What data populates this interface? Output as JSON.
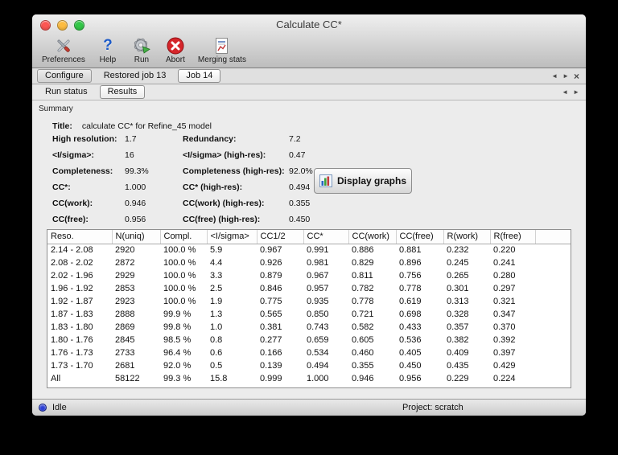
{
  "window": {
    "title": "Calculate CC*"
  },
  "toolbar": {
    "items": [
      {
        "id": "preferences",
        "label": "Preferences",
        "icon": "preferences-icon"
      },
      {
        "id": "help",
        "label": "Help",
        "icon": "help-icon"
      },
      {
        "id": "run",
        "label": "Run",
        "icon": "run-icon"
      },
      {
        "id": "abort",
        "label": "Abort",
        "icon": "abort-icon"
      },
      {
        "id": "merging-stats",
        "label": "Merging stats",
        "icon": "merging-stats-icon"
      }
    ]
  },
  "tabs": {
    "items": [
      {
        "label": "Configure",
        "active": false,
        "boxed": true
      },
      {
        "label": "Restored job 13",
        "active": false,
        "boxed": false
      },
      {
        "label": "Job 14",
        "active": true,
        "boxed": true
      }
    ]
  },
  "subtabs": {
    "items": [
      {
        "label": "Run status",
        "active": false,
        "boxed": false
      },
      {
        "label": "Results",
        "active": true,
        "boxed": true
      }
    ]
  },
  "tab_controls": {
    "scroll_left": "◄",
    "scroll_right": "►",
    "close": "×"
  },
  "summary": {
    "section_label": "Summary",
    "title_label": "Title:",
    "title_value": "calculate CC* for Refine_45 model",
    "rows": [
      {
        "label1": "High resolution:",
        "value1": "1.7",
        "label2": "Redundancy:",
        "value2": "7.2"
      },
      {
        "label1": "<I/sigma>:",
        "value1": "16",
        "label2": "<I/sigma> (high-res):",
        "value2": "0.47"
      },
      {
        "label1": "Completeness:",
        "value1": "99.3%",
        "label2": "Completeness (high-res):",
        "value2": "92.0%"
      },
      {
        "label1": "CC*:",
        "value1": "1.000",
        "label2": "CC* (high-res):",
        "value2": "0.494"
      },
      {
        "label1": "CC(work):",
        "value1": "0.946",
        "label2": "CC(work) (high-res):",
        "value2": "0.355"
      },
      {
        "label1": "CC(free):",
        "value1": "0.956",
        "label2": "CC(free) (high-res):",
        "value2": "0.450"
      }
    ],
    "display_graphs_label": "Display graphs"
  },
  "table": {
    "columns": [
      "Reso.",
      "N(uniq)",
      "Compl.",
      "<I/sigma>",
      "CC1/2",
      "CC*",
      "CC(work)",
      "CC(free)",
      "R(work)",
      "R(free)"
    ],
    "rows": [
      [
        "2.14 - 2.08",
        "2920",
        "100.0 %",
        "5.9",
        "0.967",
        "0.991",
        "0.886",
        "0.881",
        "0.232",
        "0.220"
      ],
      [
        "2.08 - 2.02",
        "2872",
        "100.0 %",
        "4.4",
        "0.926",
        "0.981",
        "0.829",
        "0.896",
        "0.245",
        "0.241"
      ],
      [
        "2.02 - 1.96",
        "2929",
        "100.0 %",
        "3.3",
        "0.879",
        "0.967",
        "0.811",
        "0.756",
        "0.265",
        "0.280"
      ],
      [
        "1.96 - 1.92",
        "2853",
        "100.0 %",
        "2.5",
        "0.846",
        "0.957",
        "0.782",
        "0.778",
        "0.301",
        "0.297"
      ],
      [
        "1.92 - 1.87",
        "2923",
        "100.0 %",
        "1.9",
        "0.775",
        "0.935",
        "0.778",
        "0.619",
        "0.313",
        "0.321"
      ],
      [
        "1.87 - 1.83",
        "2888",
        "99.9 %",
        "1.3",
        "0.565",
        "0.850",
        "0.721",
        "0.698",
        "0.328",
        "0.347"
      ],
      [
        "1.83 - 1.80",
        "2869",
        "99.8 %",
        "1.0",
        "0.381",
        "0.743",
        "0.582",
        "0.433",
        "0.357",
        "0.370"
      ],
      [
        "1.80 - 1.76",
        "2845",
        "98.5 %",
        "0.8",
        "0.277",
        "0.659",
        "0.605",
        "0.536",
        "0.382",
        "0.392"
      ],
      [
        "1.76 - 1.73",
        "2733",
        "96.4 %",
        "0.6",
        "0.166",
        "0.534",
        "0.460",
        "0.405",
        "0.409",
        "0.397"
      ],
      [
        "1.73 - 1.70",
        "2681",
        "92.0 %",
        "0.5",
        "0.139",
        "0.494",
        "0.355",
        "0.450",
        "0.435",
        "0.429"
      ],
      [
        "All",
        "58122",
        "99.3 %",
        "15.8",
        "0.999",
        "1.000",
        "0.946",
        "0.956",
        "0.229",
        "0.224"
      ]
    ]
  },
  "statusbar": {
    "status": "Idle",
    "project": "Project: scratch"
  },
  "colors": {
    "traffic_close": "#fc5753",
    "traffic_minimize": "#fdbc40",
    "traffic_zoom": "#33c748",
    "status_dot": "#2c3fd4"
  }
}
